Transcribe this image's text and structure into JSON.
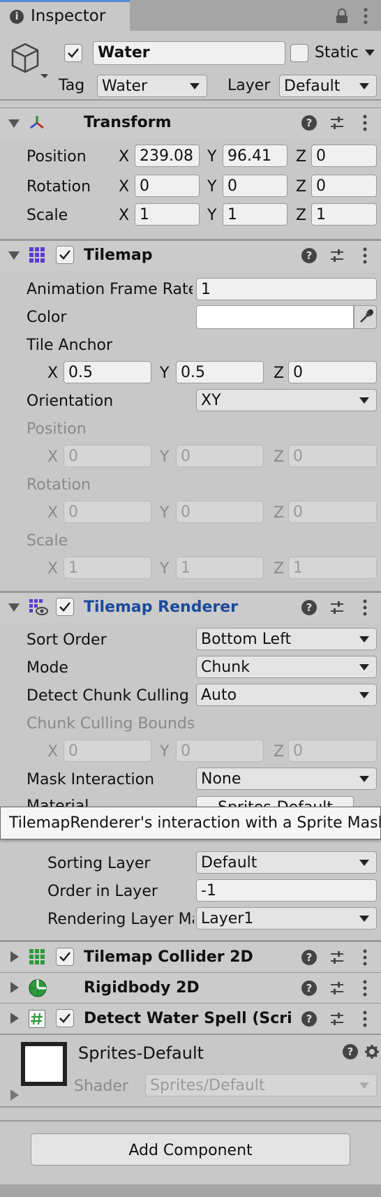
{
  "tab": {
    "title": "Inspector"
  },
  "object": {
    "active": true,
    "name": "Water",
    "static_label": "Static",
    "tag_label": "Tag",
    "tag_value": "Water",
    "layer_label": "Layer",
    "layer_value": "Default"
  },
  "transform": {
    "title": "Transform",
    "rows": [
      {
        "label": "Position",
        "x": "239.08",
        "y": "96.41",
        "z": "0"
      },
      {
        "label": "Rotation",
        "x": "0",
        "y": "0",
        "z": "0"
      },
      {
        "label": "Scale",
        "x": "1",
        "y": "1",
        "z": "1"
      }
    ]
  },
  "axis": {
    "x": "X",
    "y": "Y",
    "z": "Z"
  },
  "tilemap": {
    "title": "Tilemap",
    "anim_label": "Animation Frame Rate",
    "anim_value": "1",
    "color_label": "Color",
    "tile_anchor_label": "Tile Anchor",
    "tile_anchor": {
      "x": "0.5",
      "y": "0.5",
      "z": "0"
    },
    "orientation_label": "Orientation",
    "orientation_value": "XY",
    "position_label": "Position",
    "position": {
      "x": "0",
      "y": "0",
      "z": "0"
    },
    "rotation_label": "Rotation",
    "rotation": {
      "x": "0",
      "y": "0",
      "z": "0"
    },
    "scale_label": "Scale",
    "scale": {
      "x": "1",
      "y": "1",
      "z": "1"
    }
  },
  "renderer": {
    "title": "Tilemap Renderer",
    "sort_order_label": "Sort Order",
    "sort_order_value": "Bottom Left",
    "mode_label": "Mode",
    "mode_value": "Chunk",
    "culling_label": "Detect Chunk Culling",
    "culling_value": "Auto",
    "bounds_label": "Chunk Culling Bounds",
    "bounds": {
      "x": "0",
      "y": "0",
      "z": "0"
    },
    "mask_label": "Mask Interaction",
    "mask_value": "None",
    "material_label": "Material",
    "material_value": "Sprites-Default",
    "tooltip": "TilemapRenderer's interaction with a Sprite Mask",
    "sorting_layer_label": "Sorting Layer",
    "sorting_layer_value": "Default",
    "order_label": "Order in Layer",
    "order_value": "-1",
    "rendering_layer_label": "Rendering Layer Mask",
    "rendering_layer_value": "Layer1"
  },
  "components": [
    {
      "title": "Tilemap Collider 2D"
    },
    {
      "title": "Rigidbody 2D"
    },
    {
      "title": "Detect Water Spell (Script)"
    }
  ],
  "material": {
    "name": "Sprites-Default",
    "shader_label": "Shader",
    "shader_value": "Sprites/Default"
  },
  "add_component_label": "Add Component",
  "colors": {
    "accent_title": "#1a4a9c",
    "background": "#c8c8c8",
    "field": "#f0f0f0"
  }
}
